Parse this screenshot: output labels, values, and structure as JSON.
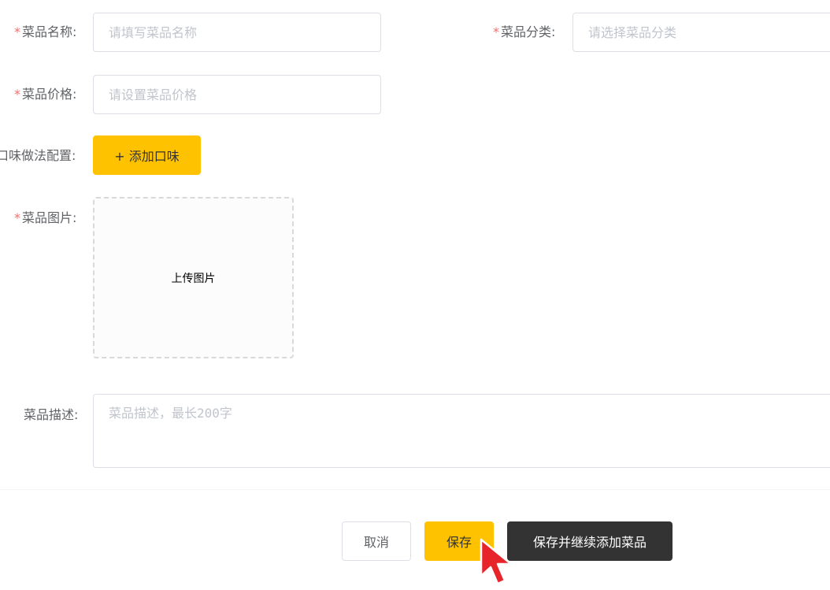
{
  "form": {
    "required_mark": "*",
    "dish_name": {
      "label": "菜品名称:",
      "placeholder": "请填写菜品名称",
      "value": ""
    },
    "dish_category": {
      "label": "菜品分类:",
      "placeholder": "请选择菜品分类",
      "value": ""
    },
    "dish_price": {
      "label": "菜品价格:",
      "placeholder": "请设置菜品价格",
      "value": ""
    },
    "flavor_config": {
      "label": "口味做法配置:",
      "add_button_label": "+ 添加口味"
    },
    "dish_image": {
      "label": "菜品图片:",
      "upload_text": "上传图片"
    },
    "dish_description": {
      "label": "菜品描述:",
      "placeholder": "菜品描述，最长200字",
      "value": ""
    }
  },
  "actions": {
    "cancel_label": "取消",
    "save_label": "保存",
    "save_continue_label": "保存并继续添加菜品"
  },
  "colors": {
    "accent": "#ffc200",
    "dark_button": "#333333",
    "required": "#f56c6c",
    "cursor": "#e8242b"
  },
  "icons": {
    "cursor": "mouse-pointer-icon"
  }
}
